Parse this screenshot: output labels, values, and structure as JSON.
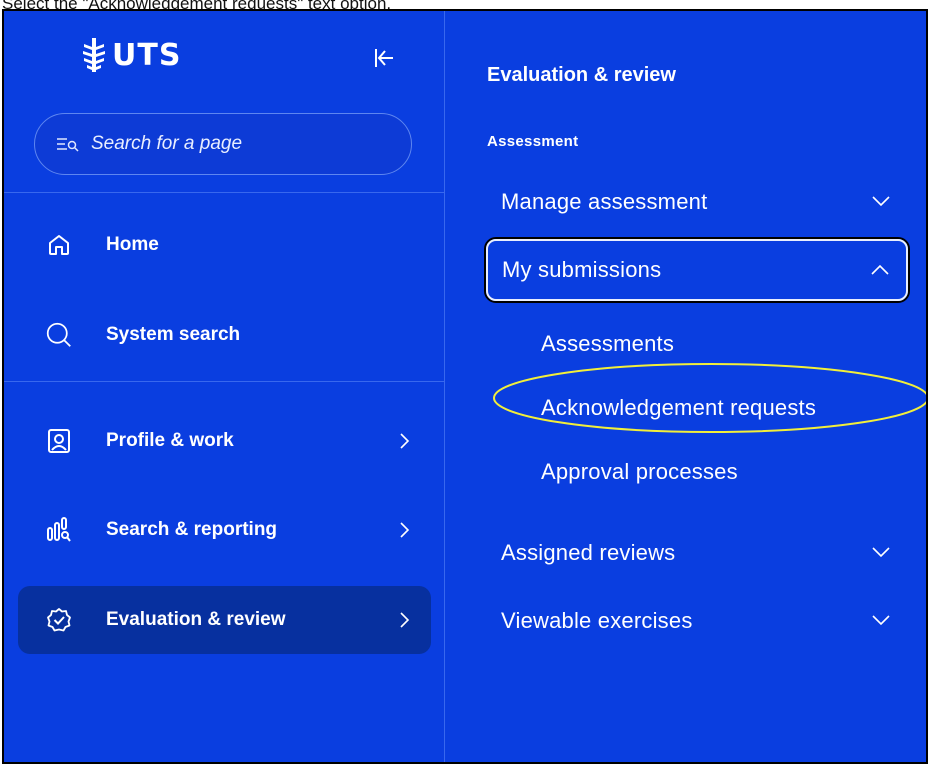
{
  "instruction": "Select the \"Acknowledgement requests\" text option.",
  "brand": {
    "name": "UTS"
  },
  "search": {
    "placeholder": "Search for a page"
  },
  "sidebar": {
    "items": [
      {
        "label": "Home",
        "icon": "home-icon"
      },
      {
        "label": "System search",
        "icon": "search-icon"
      },
      {
        "label": "Profile & work",
        "icon": "profile-icon",
        "has_submenu": true
      },
      {
        "label": "Search & reporting",
        "icon": "reporting-icon",
        "has_submenu": true
      },
      {
        "label": "Evaluation & review",
        "icon": "badge-check-icon",
        "has_submenu": true,
        "active": true
      }
    ]
  },
  "flyout": {
    "title": "Evaluation & review",
    "section": "Assessment",
    "menus": [
      {
        "label": "Manage assessment",
        "state": "collapsed"
      },
      {
        "label": "My submissions",
        "state": "expanded",
        "children": [
          "Assessments",
          "Acknowledgement requests",
          "Approval processes"
        ]
      },
      {
        "label": "Assigned reviews",
        "state": "collapsed"
      },
      {
        "label": "Viewable exercises",
        "state": "collapsed"
      }
    ]
  },
  "colors": {
    "background": "#0a3ee0",
    "active_item": "#07309f",
    "highlight_ellipse": "#f2ef3a",
    "text": "#ffffff"
  }
}
